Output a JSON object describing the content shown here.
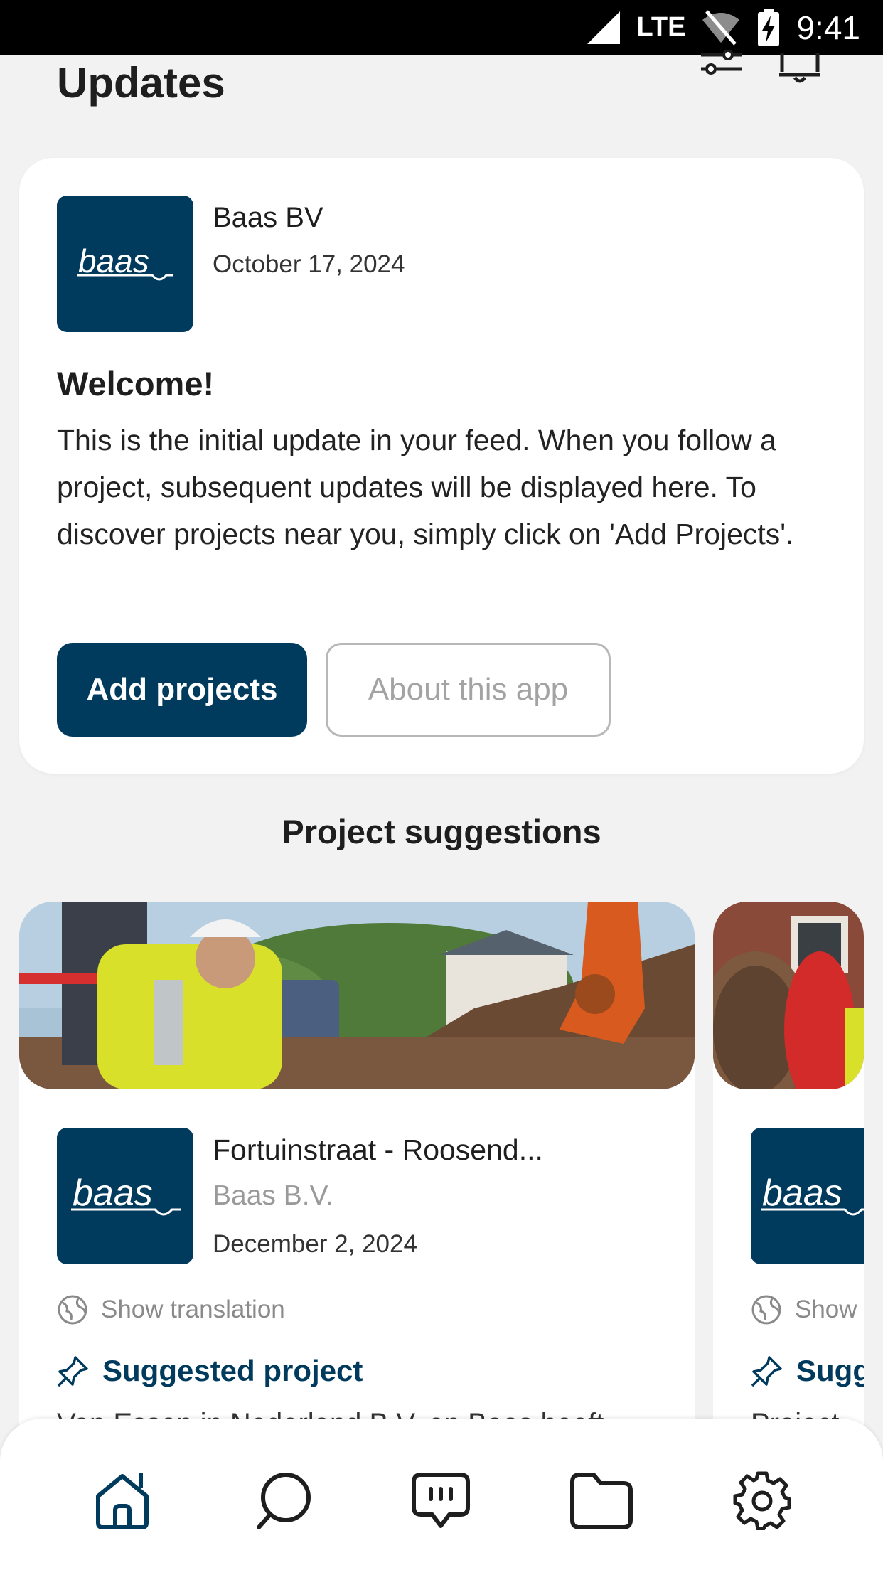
{
  "status_bar": {
    "network": "LTE",
    "time": "9:41"
  },
  "header": {
    "title": "Updates"
  },
  "welcome_card": {
    "org_name": "Baas BV",
    "date": "October 17, 2024",
    "title": "Welcome!",
    "body": "This is the initial update in your feed. When you follow a project, subsequent updates will be displayed here. To discover projects near you, simply click on 'Add Projects'.",
    "primary_button": "Add projects",
    "secondary_button": "About this app"
  },
  "suggestions": {
    "title": "Project suggestions",
    "cards": [
      {
        "title": "Fortuinstraat - Roosend...",
        "org": "Baas B.V.",
        "date": "December 2, 2024",
        "translation_label": "Show translation",
        "suggested_label": "Suggested project",
        "preview_text": "Van Essen in Nederland B.V. en Baas heeft..."
      },
      {
        "translation_label": "Show",
        "suggested_label": "Sugg",
        "preview_text": "Project..."
      }
    ]
  },
  "logo_text": "baas",
  "colors": {
    "brand": "#003a5d",
    "background": "#f2f2f2"
  },
  "nav": [
    {
      "icon": "home-icon",
      "active": true
    },
    {
      "icon": "search-icon"
    },
    {
      "icon": "chat-icon"
    },
    {
      "icon": "folder-icon"
    },
    {
      "icon": "gear-icon"
    }
  ]
}
